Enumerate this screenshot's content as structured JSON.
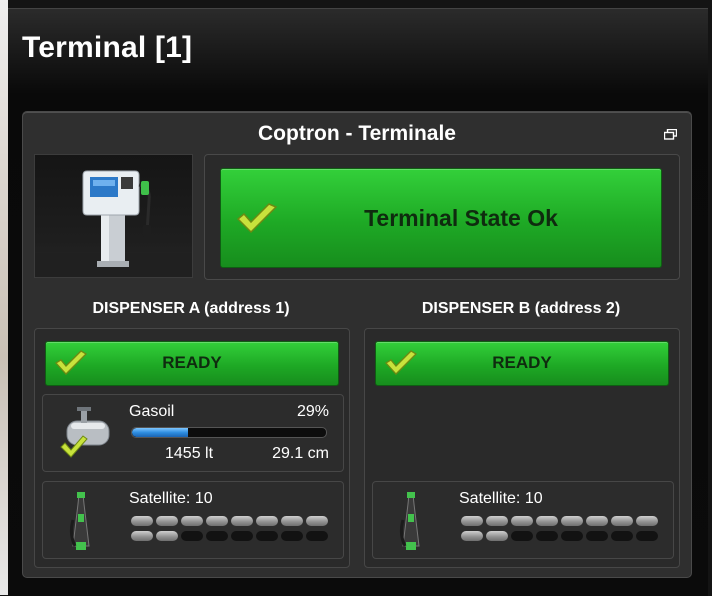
{
  "window": {
    "title": "Terminal [1]"
  },
  "panel": {
    "title": "Coptron - Terminale"
  },
  "terminal_state": {
    "label": "Terminal State Ok"
  },
  "dispensers": [
    {
      "title": "DISPENSER A (address 1)",
      "status": "READY",
      "tank": {
        "fuel": "Gasoil",
        "percent": "29%",
        "level": 0.29,
        "liters": "1455 lt",
        "height": "29.1 cm"
      },
      "satellite": {
        "label": "Satellite: 10",
        "signal": [
          1,
          1,
          1,
          1,
          1,
          1,
          1,
          1,
          1,
          1,
          0,
          0,
          0,
          0,
          0,
          0
        ]
      }
    },
    {
      "title": "DISPENSER B (address 2)",
      "status": "READY",
      "satellite": {
        "label": "Satellite: 10",
        "signal": [
          1,
          1,
          1,
          1,
          1,
          1,
          1,
          1,
          1,
          1,
          0,
          0,
          0,
          0,
          0,
          0
        ]
      }
    }
  ],
  "colors": {
    "ok_green": "#1ea925",
    "check_yellow": "#c8e23c",
    "level_blue": "#2e8de0"
  },
  "icons": [
    "restore-window-icon",
    "fuel-pump-image",
    "checkmark-icon",
    "fuel-tank-icon",
    "fuel-nozzle-icon"
  ]
}
